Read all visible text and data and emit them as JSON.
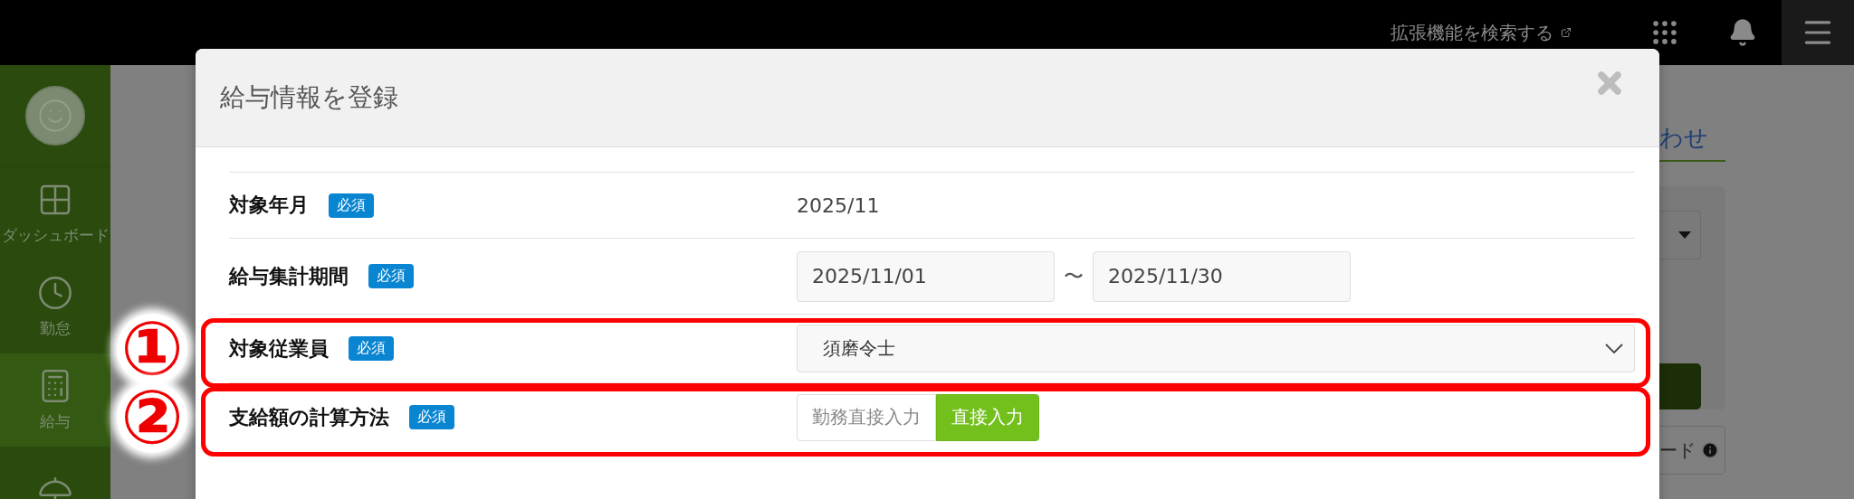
{
  "topbar": {
    "search_link": "拡張機能を検索する"
  },
  "sidebar": {
    "items": [
      {
        "kind": "dashboard",
        "label": "ダッシュボード",
        "selected": false
      },
      {
        "kind": "clock",
        "label": "勤怠",
        "selected": false
      },
      {
        "kind": "calculator",
        "label": "給与",
        "selected": true
      },
      {
        "kind": "umbrella",
        "selected": false
      }
    ]
  },
  "background": {
    "tab_text": "わせ",
    "button_text": "ード"
  },
  "modal": {
    "title": "給与情報を登録",
    "rows": [
      {
        "kind": "text",
        "label": "対象年月",
        "badge": "必須",
        "value": "2025/11"
      },
      {
        "kind": "range",
        "label": "給与集計期間",
        "badge": "必須",
        "from": "2025/11/01",
        "separator": "〜",
        "to": "2025/11/30"
      },
      {
        "kind": "select",
        "label": "対象従業員",
        "badge": "必須",
        "value": "須磨令士",
        "annotation": "①"
      },
      {
        "kind": "toggle",
        "label": "支給額の計算方法",
        "badge": "必須",
        "annotation": "②",
        "options": [
          {
            "label": "勤務直接入力",
            "selected": false
          },
          {
            "label": "直接入力",
            "selected": true
          }
        ]
      }
    ]
  }
}
